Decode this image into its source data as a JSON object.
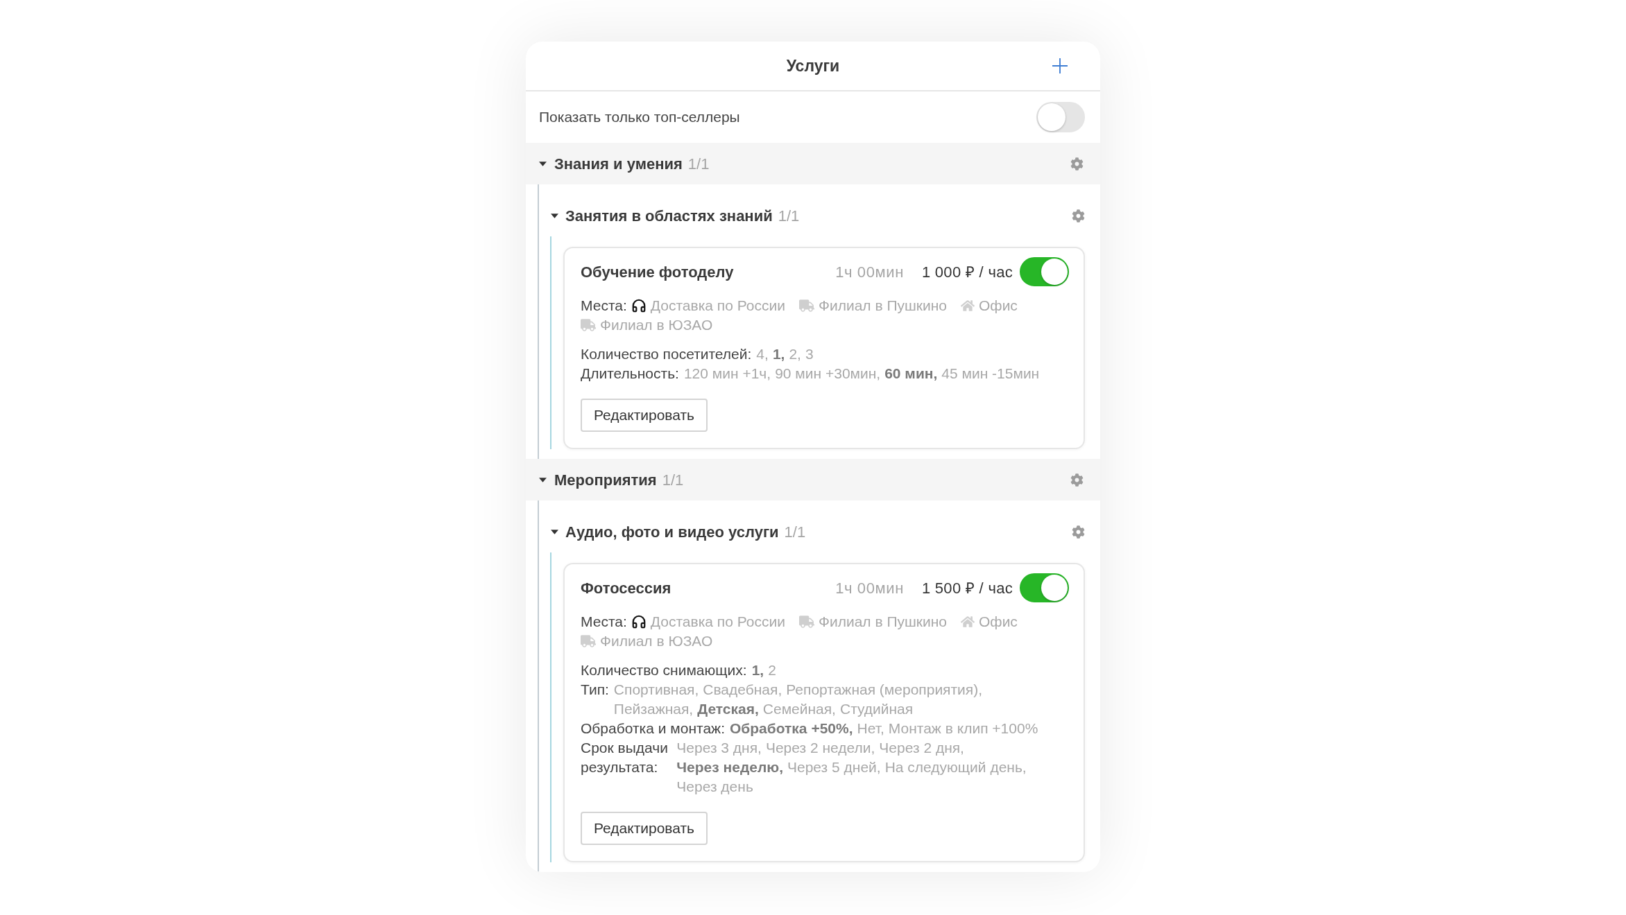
{
  "header": {
    "title": "Услуги"
  },
  "filter": {
    "label": "Показать только топ-селлеры",
    "on": false
  },
  "groups": [
    {
      "title": "Знания и умения",
      "count": "1/1",
      "expanded": true,
      "subgroups": [
        {
          "title": "Занятия в областях знаний",
          "count": "1/1",
          "expanded": true,
          "services": [
            {
              "name": "Обучение фотоделу",
              "duration": "1ч 00мин",
              "price": "1 000 ₽ / час",
              "on": true,
              "places_label": "Места:",
              "places": [
                {
                  "kind": "delivery",
                  "name": "Доставка по России"
                },
                {
                  "kind": "branch",
                  "name": "Филиал в Пушкино"
                },
                {
                  "kind": "office",
                  "name": "Офис"
                },
                {
                  "kind": "branch",
                  "name": "Филиал в ЮЗАО"
                }
              ],
              "attributes": [
                {
                  "label": "Количество посетителей:",
                  "options": [
                    {
                      "text": "4,",
                      "selected": false
                    },
                    {
                      "text": "1,",
                      "selected": true
                    },
                    {
                      "text": "2,",
                      "selected": false
                    },
                    {
                      "text": "3",
                      "selected": false
                    }
                  ]
                },
                {
                  "label": "Длительность:",
                  "options": [
                    {
                      "text": "120 мин +1ч,",
                      "selected": false
                    },
                    {
                      "text": "90 мин +30мин,",
                      "selected": false
                    },
                    {
                      "text": "60 мин,",
                      "selected": true
                    },
                    {
                      "text": "45 мин -15мин",
                      "selected": false
                    }
                  ]
                }
              ],
              "edit_button": "Редактировать"
            }
          ]
        }
      ]
    },
    {
      "title": "Мероприятия",
      "count": "1/1",
      "expanded": true,
      "subgroups": [
        {
          "title": "Аудио, фото и видео услуги",
          "count": "1/1",
          "expanded": true,
          "services": [
            {
              "name": "Фотосессия",
              "duration": "1ч 00мин",
              "price": "1 500 ₽ / час",
              "on": true,
              "places_label": "Места:",
              "places": [
                {
                  "kind": "delivery",
                  "name": "Доставка по России"
                },
                {
                  "kind": "branch",
                  "name": "Филиал в Пушкино"
                },
                {
                  "kind": "office",
                  "name": "Офис"
                },
                {
                  "kind": "branch",
                  "name": "Филиал в ЮЗАО"
                }
              ],
              "attributes": [
                {
                  "label": "Количество снимающих:",
                  "options": [
                    {
                      "text": "1,",
                      "selected": true
                    },
                    {
                      "text": "2",
                      "selected": false
                    }
                  ]
                },
                {
                  "label": "Тип:",
                  "options": [
                    {
                      "text": "Спортивная,",
                      "selected": false
                    },
                    {
                      "text": "Свадебная,",
                      "selected": false
                    },
                    {
                      "text": "Репортажная (мероприятия),",
                      "selected": false
                    },
                    {
                      "text": "Пейзажная,",
                      "selected": false
                    },
                    {
                      "text": "Детская,",
                      "selected": true
                    },
                    {
                      "text": "Семейная,",
                      "selected": false
                    },
                    {
                      "text": "Студийная",
                      "selected": false
                    }
                  ]
                },
                {
                  "label": "Обработка и монтаж:",
                  "options": [
                    {
                      "text": "Обработка +50%,",
                      "selected": true
                    },
                    {
                      "text": "Нет,",
                      "selected": false
                    },
                    {
                      "text": "Монтаж в клип +100%",
                      "selected": false
                    }
                  ]
                },
                {
                  "label": "Срок выдачи результата:",
                  "options": [
                    {
                      "text": "Через 3 дня,",
                      "selected": false
                    },
                    {
                      "text": "Через 2 недели,",
                      "selected": false
                    },
                    {
                      "text": "Через 2 дня,",
                      "selected": false
                    },
                    {
                      "text": "Через неделю,",
                      "selected": true
                    },
                    {
                      "text": "Через 5 дней,",
                      "selected": false
                    },
                    {
                      "text": "На следующий день,",
                      "selected": false
                    },
                    {
                      "text": "Через день",
                      "selected": false
                    }
                  ]
                }
              ],
              "edit_button": "Редактировать"
            }
          ]
        }
      ]
    }
  ]
}
